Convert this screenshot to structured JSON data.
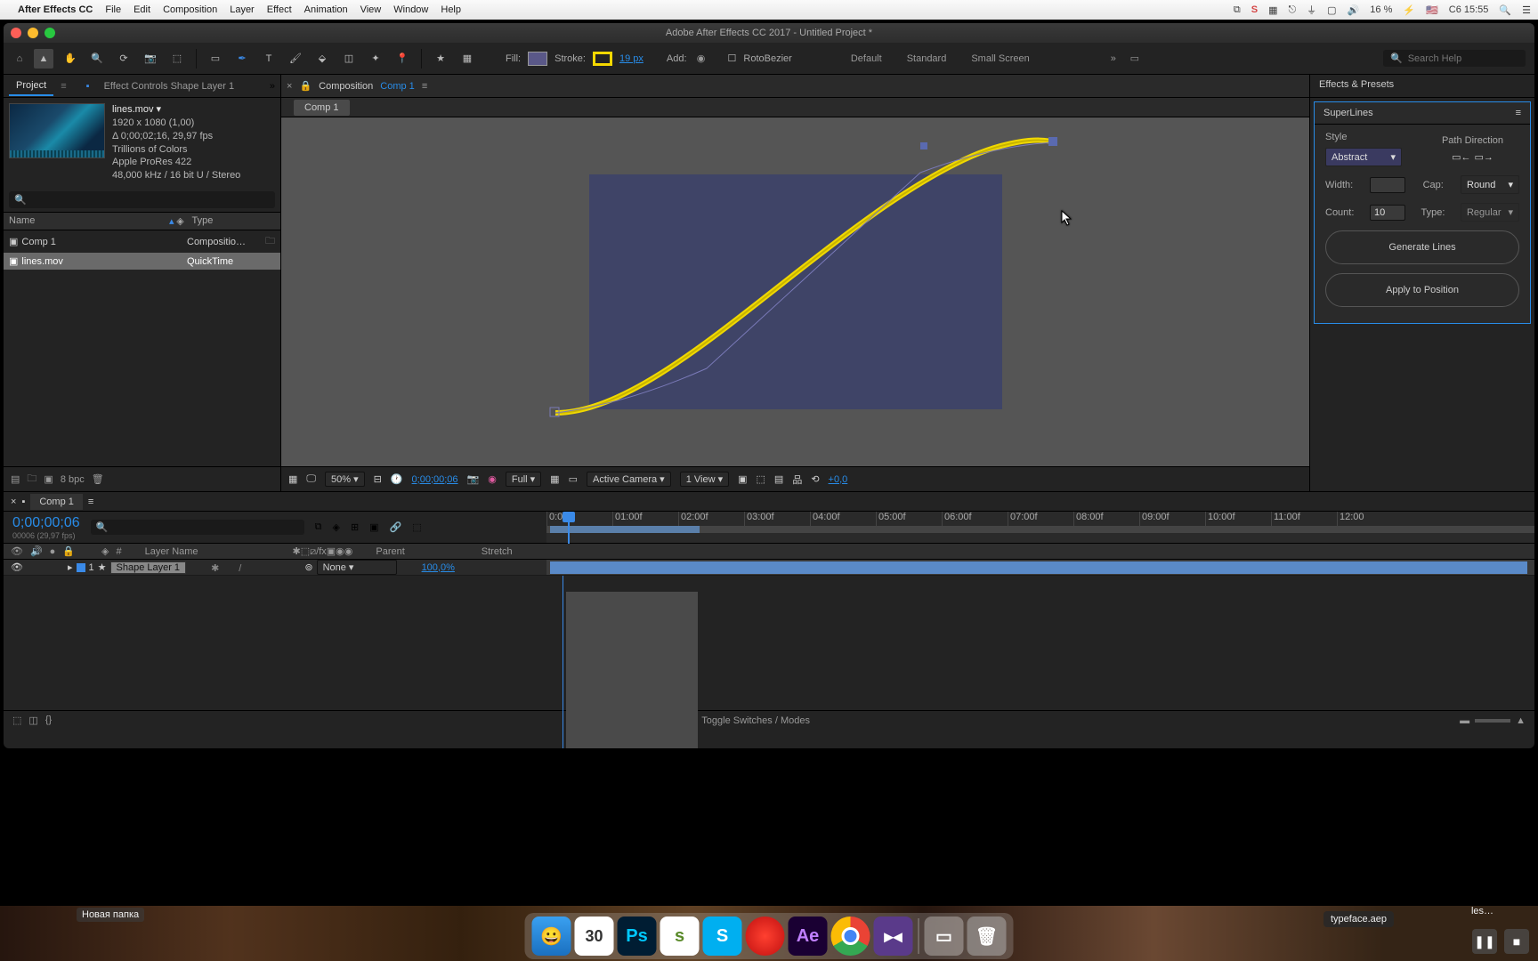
{
  "menubar": {
    "app": "After Effects CC",
    "items": [
      "File",
      "Edit",
      "Composition",
      "Layer",
      "Effect",
      "Animation",
      "View",
      "Window",
      "Help"
    ],
    "battery": "16 %",
    "clock_label": "C6 15:55"
  },
  "window": {
    "title": "Adobe After Effects CC 2017 - Untitled Project *"
  },
  "toolbar": {
    "fill_label": "Fill:",
    "stroke_label": "Stroke:",
    "stroke_px": "19 px",
    "add_label": "Add:",
    "rotobezier": "RotoBezier",
    "layouts": [
      "Default",
      "Standard",
      "Small Screen"
    ],
    "search_placeholder": "Search Help"
  },
  "left": {
    "tab_project": "Project",
    "tab_effect": "Effect Controls Shape Layer 1",
    "asset": {
      "name": "lines.mov ▾",
      "res": "1920 x 1080 (1,00)",
      "dur": "Δ 0;00;02;16, 29,97 fps",
      "colors": "Trillions of Colors",
      "codec": "Apple ProRes 422",
      "audio": "48,000 kHz / 16 bit U / Stereo"
    },
    "col_name": "Name",
    "col_type": "Type",
    "items": [
      {
        "name": "Comp 1",
        "type": "Compositio…",
        "selected": false
      },
      {
        "name": "lines.mov",
        "type": "QuickTime",
        "selected": true
      }
    ],
    "bpc": "8 bpc"
  },
  "center": {
    "comp_tab": "Composition",
    "comp_name": "Comp 1",
    "sub_tab": "Comp 1",
    "footer": {
      "zoom": "50%",
      "time": "0;00;00;06",
      "res": "Full",
      "camera": "Active Camera",
      "views": "1 View",
      "exposure": "+0,0"
    }
  },
  "right": {
    "header": "Effects & Presets",
    "plugin": "SuperLines",
    "style_label": "Style",
    "style_value": "Abstract",
    "path_label": "Path Direction",
    "width_label": "Width:",
    "cap_label": "Cap:",
    "cap_value": "Round",
    "count_label": "Count:",
    "count_value": "10",
    "type_label": "Type:",
    "type_value": "Regular",
    "generate": "Generate Lines",
    "apply": "Apply to Position"
  },
  "timeline": {
    "tab": "Comp 1",
    "timecode": "0;00;00;06",
    "timecode_sub": "00006 (29,97 fps)",
    "ruler": [
      "0:00f",
      "01:00f",
      "02:00f",
      "03:00f",
      "04:00f",
      "05:00f",
      "06:00f",
      "07:00f",
      "08:00f",
      "09:00f",
      "10:00f",
      "11:00f",
      "12:00"
    ],
    "col_index": "#",
    "col_layer": "Layer Name",
    "col_parent": "Parent",
    "col_stretch": "Stretch",
    "layer": {
      "index": "1",
      "name": "Shape Layer 1",
      "parent": "None",
      "stretch": "100,0%"
    },
    "toggle": "Toggle Switches / Modes"
  },
  "desktop": {
    "folder": "Новая папка",
    "file1": "typeface.aep",
    "file2": "les…",
    "cal_day": "30"
  }
}
